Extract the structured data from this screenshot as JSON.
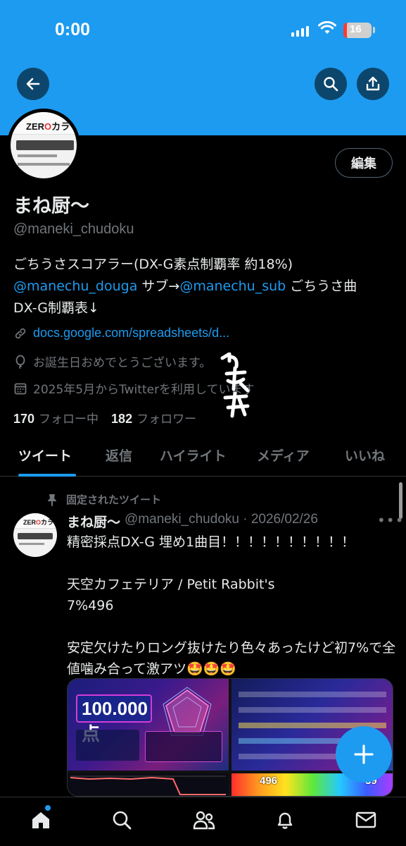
{
  "status_bar": {
    "time": "0:00",
    "battery": "16"
  },
  "profile": {
    "edit_label": "編集",
    "display_name": "まね厨〜",
    "handle": "@maneki_chudoku",
    "bio_line1": "ごちうさスコアラー(DX-G素点制覇率 約18%)",
    "bio_mention1": "@manechu_douga",
    "bio_text2": " サブ→",
    "bio_mention2": "@manechu_sub",
    "bio_text3": " ごちうさ曲",
    "bio_line3": "DX-G制覇表↓",
    "website": "docs.google.com/spreadsheets/d...",
    "birthday": "お誕生日おめでとうございます。",
    "joined": "2025年5月からTwitterを利用しています",
    "following_count": "170",
    "following_label": "フォロー中",
    "followers_count": "182",
    "followers_label": "フォロワー"
  },
  "avatar_image": {
    "logo_prefix": "ZER",
    "logo_suffix": "カラ"
  },
  "tabs": [
    {
      "label": "ツイート"
    },
    {
      "label": "返信"
    },
    {
      "label": "ハイライト"
    },
    {
      "label": "メディア"
    },
    {
      "label": "いいね"
    }
  ],
  "tweet": {
    "pinned_label": "固定されたツイート",
    "name": "まね厨〜",
    "handle_date": "@maneki_chudoku · 2026/02/26",
    "text": "精密採点DX-G 埋め1曲目！！！！！！！！！！\n\n天空カフェテリア / Petit Rabbit's\n7%496\n\n安定欠けたりロング抜けたり色々あったけど初7%で全値噛み合って激アツ🤩🤩🤩",
    "media": {
      "score": "100.000点",
      "value_left": "496",
      "value_right": "39"
    }
  },
  "colors": {
    "accent": "#1d9bf0",
    "background": "#000000",
    "secondary_text": "#71767b"
  }
}
